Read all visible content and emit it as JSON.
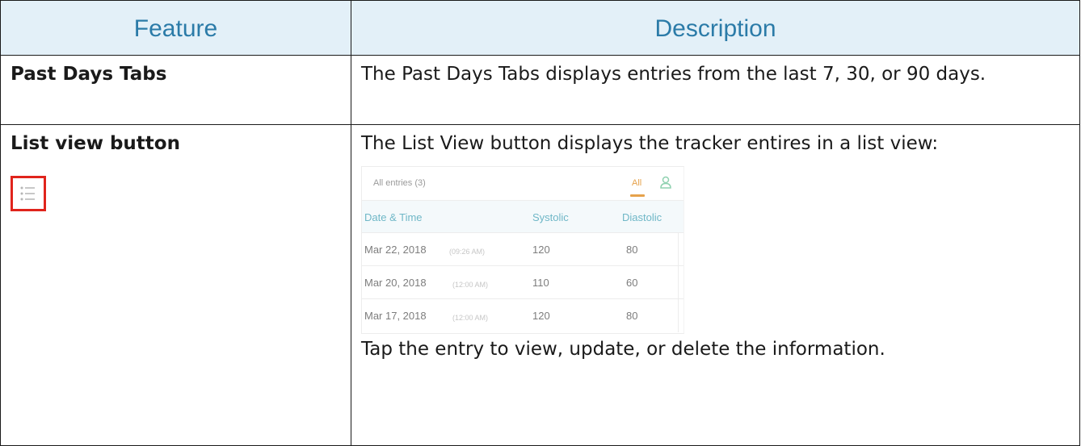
{
  "table": {
    "headers": [
      "Feature",
      "Description"
    ],
    "rows": [
      {
        "feature": "Past Days Tabs",
        "description": "The Past Days Tabs displays entries from the last 7, 30, or 90 days."
      },
      {
        "feature": "List view button",
        "description": "The List View button displays the tracker entires in a list view:",
        "icon": "list-icon",
        "icon_highlight_color": "#e0241c",
        "after_image": "Tap the entry to view, update, or delete the information."
      }
    ]
  },
  "screenshot": {
    "title": "All entries (3)",
    "tab_all": "All",
    "tab_user_icon": "person-icon",
    "columns": [
      "Date & Time",
      "Systolic",
      "Diastolic"
    ],
    "entries": [
      {
        "date": "Mar 22, 2018",
        "time": "(09:26 AM)",
        "systolic": "120",
        "diastolic": "80"
      },
      {
        "date": "Mar 20, 2018",
        "time": "(12:00 AM)",
        "systolic": "110",
        "diastolic": "60"
      },
      {
        "date": "Mar 17, 2018",
        "time": "(12:00 AM)",
        "systolic": "120",
        "diastolic": "80"
      }
    ]
  },
  "colors": {
    "header_background": "#e3f0f8",
    "header_text": "#2b7ba8",
    "accent_orange": "#e6a24b",
    "accent_teal": "#6fb7c7"
  }
}
